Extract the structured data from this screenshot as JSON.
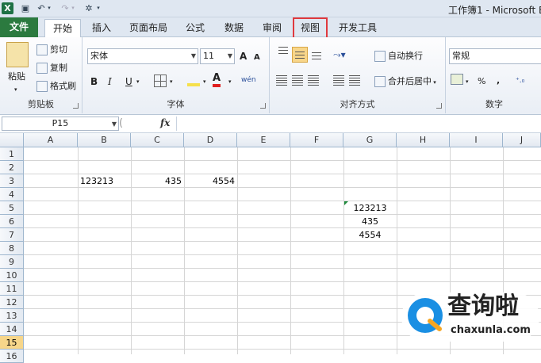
{
  "titlebar": {
    "title": "工作簿1 - Microsoft E",
    "app_icon": "X"
  },
  "tabs": [
    {
      "label": "文件",
      "key": "file"
    },
    {
      "label": "开始",
      "key": "home"
    },
    {
      "label": "插入",
      "key": "insert"
    },
    {
      "label": "页面布局",
      "key": "layout"
    },
    {
      "label": "公式",
      "key": "formula"
    },
    {
      "label": "数据",
      "key": "data"
    },
    {
      "label": "审阅",
      "key": "review"
    },
    {
      "label": "视图",
      "key": "view"
    },
    {
      "label": "开发工具",
      "key": "dev"
    }
  ],
  "ribbon": {
    "clipboard": {
      "label": "剪贴板",
      "paste": "粘贴",
      "cut": "剪切",
      "copy": "复制",
      "format_painter": "格式刷"
    },
    "font": {
      "label": "字体",
      "name": "宋体",
      "size": "11",
      "bold": "B",
      "italic": "I",
      "underline": "U",
      "grow": "A",
      "shrink": "A",
      "font_color": "A",
      "phonetic": "wén"
    },
    "alignment": {
      "label": "对齐方式",
      "wrap": "自动换行",
      "merge": "合并后居中"
    },
    "number": {
      "label": "数字",
      "format": "常规",
      "percent": "%",
      "comma": ","
    }
  },
  "formula_bar": {
    "name_box": "P15",
    "fx": "fx",
    "value": ""
  },
  "sheet": {
    "columns": [
      "A",
      "B",
      "C",
      "D",
      "E",
      "F",
      "G",
      "H",
      "I",
      "J"
    ],
    "rows": [
      "1",
      "2",
      "3",
      "4",
      "5",
      "6",
      "7",
      "8",
      "9",
      "10",
      "11",
      "12",
      "13",
      "14",
      "15",
      "16"
    ],
    "selected_row": "15",
    "cells": {
      "B3": "123213",
      "C3": "435",
      "D3": "4554",
      "G5": "123213",
      "G6": "435",
      "G7": "4554"
    }
  },
  "watermark": {
    "text": "查询啦",
    "url": "chaxunla.com",
    "accent": "#1a8fe3"
  }
}
